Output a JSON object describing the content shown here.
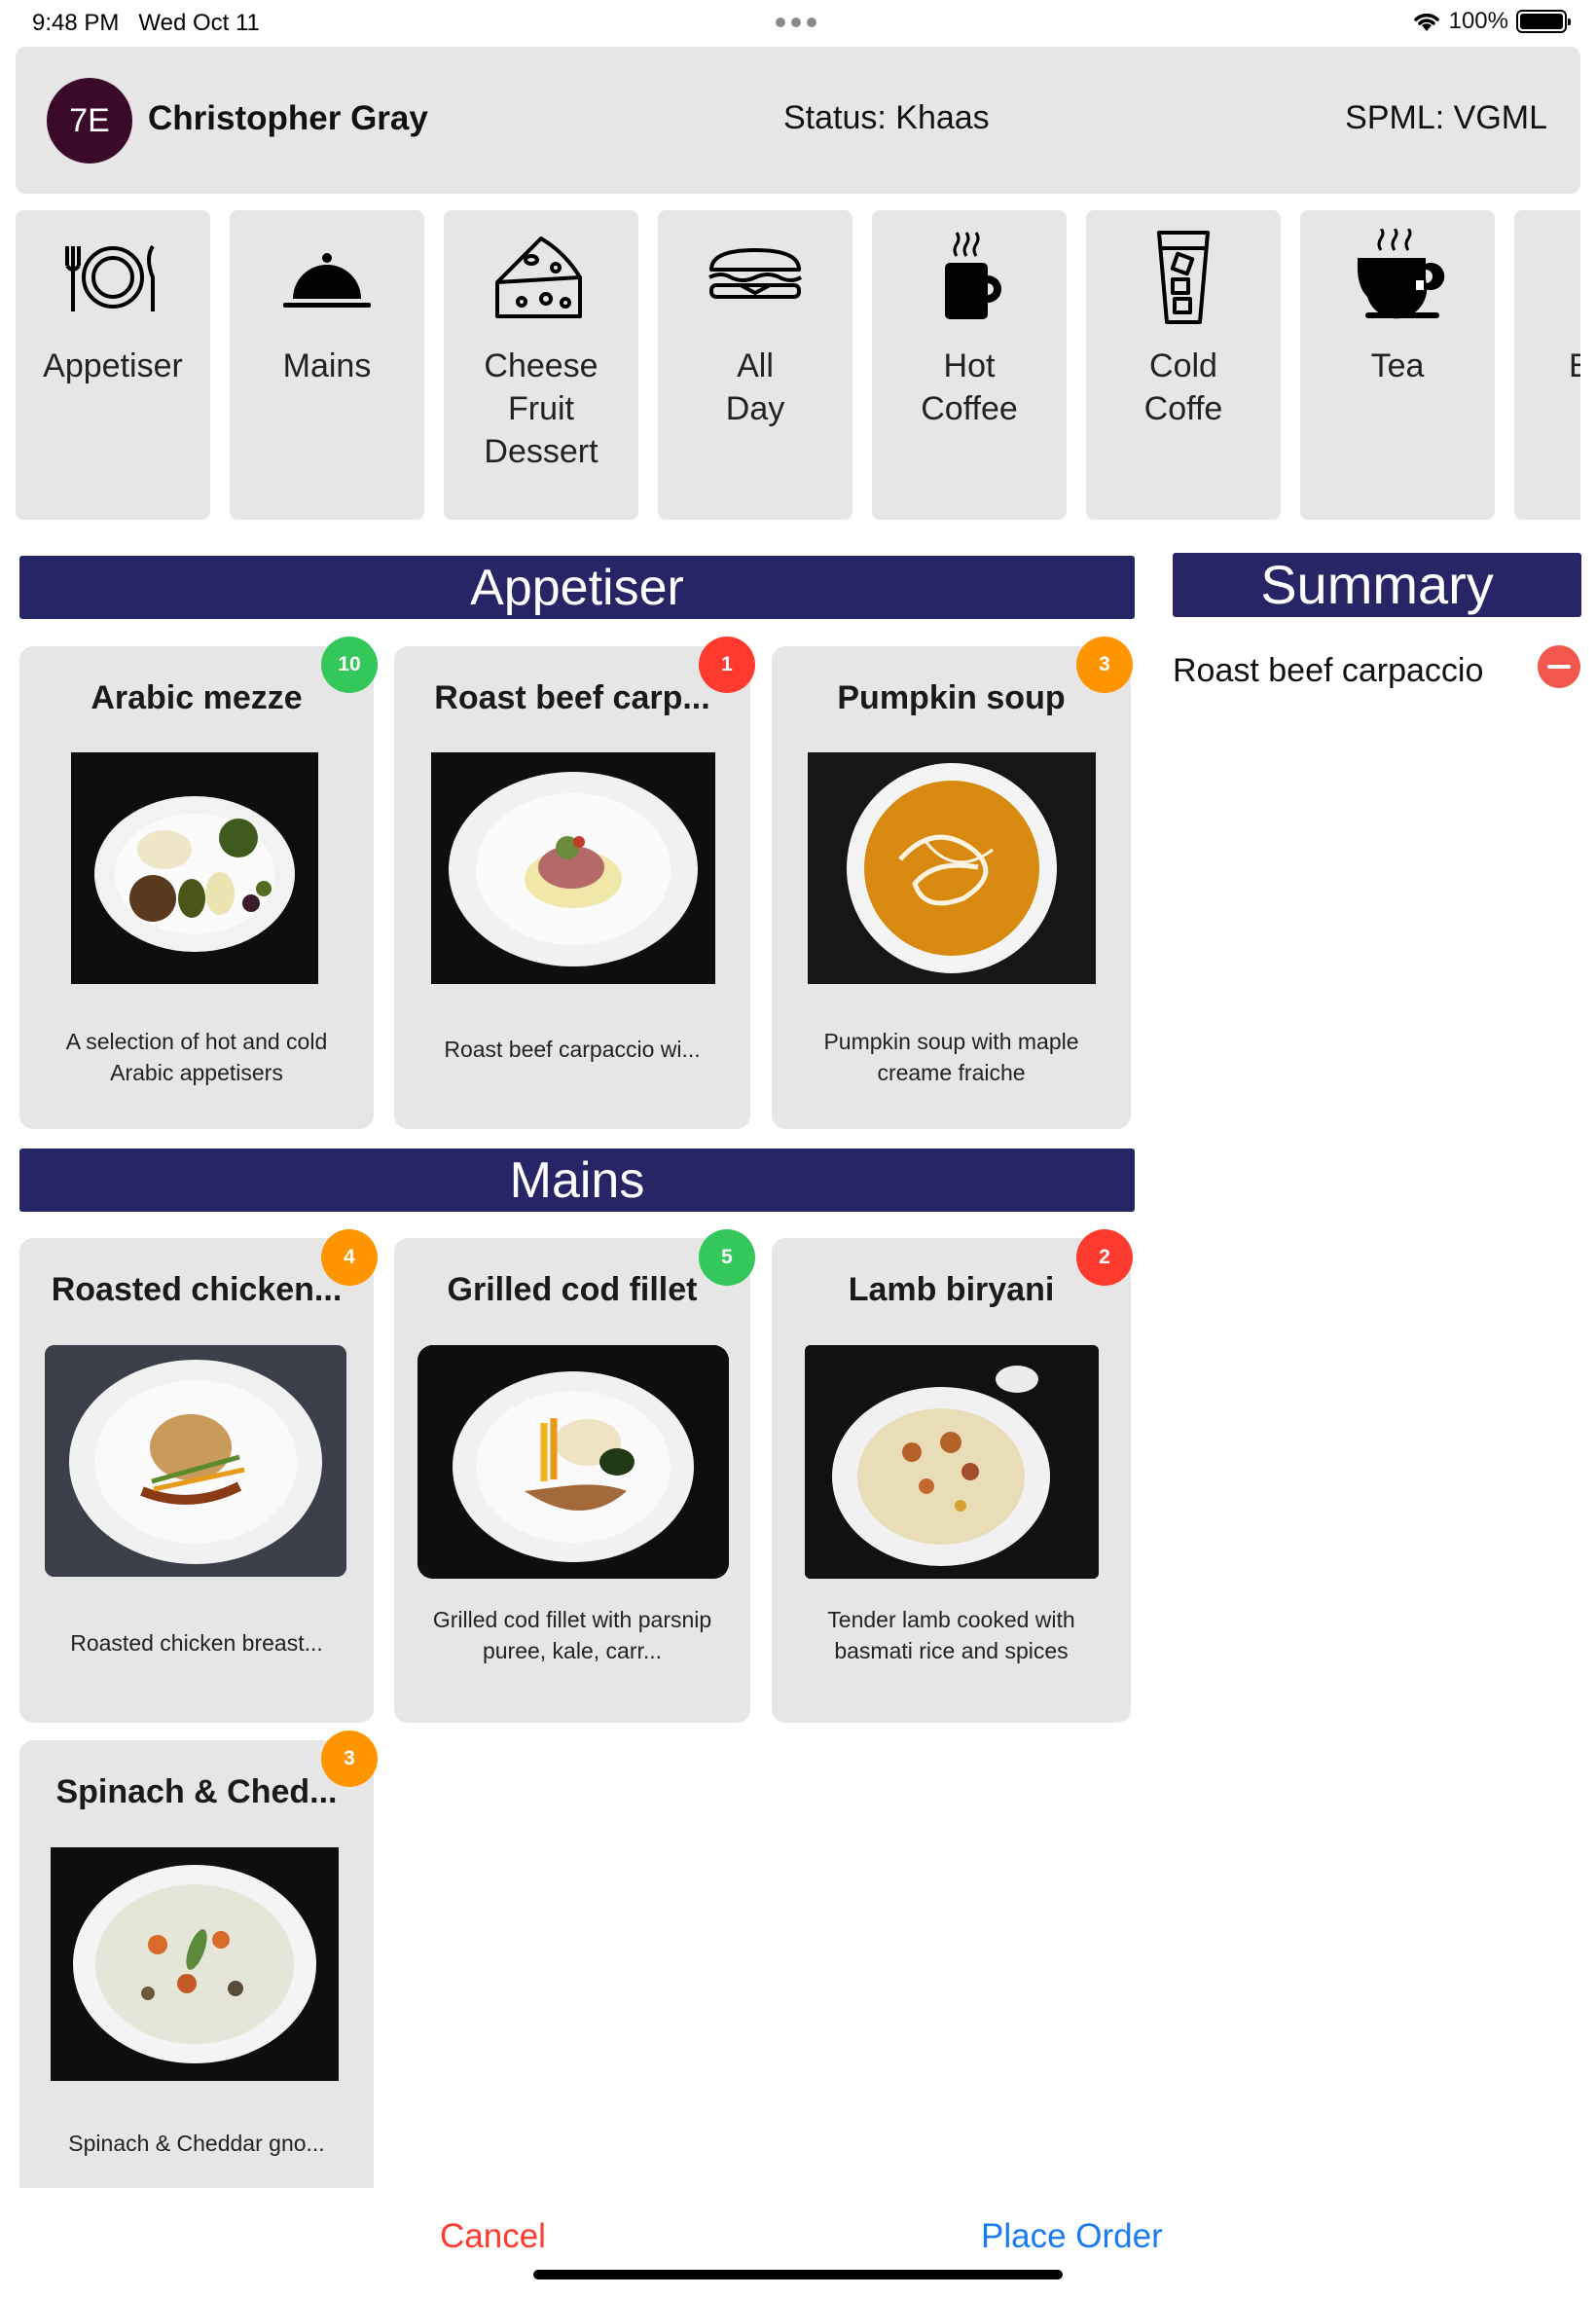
{
  "status_bar": {
    "time": "9:48 PM",
    "date": "Wed Oct 11",
    "battery": "100%"
  },
  "passenger": {
    "initials": "7E",
    "name": "Christopher Gray",
    "status": "Status: Khaas",
    "spml": "SPML: VGML"
  },
  "categories": [
    {
      "label": "Appetiser",
      "icon": "plate-cutlery-icon"
    },
    {
      "label": "Mains",
      "icon": "cloche-icon"
    },
    {
      "label": "Cheese\nFruit\nDessert",
      "icon": "cheese-icon"
    },
    {
      "label": "All\nDay",
      "icon": "sandwich-icon"
    },
    {
      "label": "Hot\nCoffee",
      "icon": "hot-coffee-icon"
    },
    {
      "label": "Cold\nCoffe",
      "icon": "iced-coffee-icon"
    },
    {
      "label": "Tea",
      "icon": "tea-cup-icon"
    },
    {
      "label": "E",
      "icon": ""
    }
  ],
  "sections": {
    "appetiser": "Appetiser",
    "mains": "Mains",
    "summary": "Summary"
  },
  "appetisers": [
    {
      "title": "Arabic mezze",
      "description": "A selection of hot and cold Arabic appetisers",
      "count": "10",
      "badge_color": "#34c759"
    },
    {
      "title": "Roast beef carp...",
      "description": "Roast beef carpaccio wi...",
      "count": "1",
      "badge_color": "#ff3b30"
    },
    {
      "title": "Pumpkin soup",
      "description": "Pumpkin soup with maple creame fraiche",
      "count": "3",
      "badge_color": "#ff9500"
    }
  ],
  "mains": [
    {
      "title": "Roasted chicken...",
      "description": "Roasted chicken breast...",
      "count": "4",
      "badge_color": "#ff9500"
    },
    {
      "title": "Grilled cod fillet",
      "description": "Grilled cod fillet with parsnip puree, kale, carr...",
      "count": "5",
      "badge_color": "#34c759"
    },
    {
      "title": "Lamb biryani",
      "description": "Tender lamb cooked with basmati rice and spices",
      "count": "2",
      "badge_color": "#ff3b30"
    },
    {
      "title": "Spinach & Ched...",
      "description": "Spinach & Cheddar gno...",
      "count": "3",
      "badge_color": "#ff9500"
    }
  ],
  "summary": {
    "items": [
      "Roast beef carpaccio"
    ]
  },
  "footer": {
    "cancel": "Cancel",
    "place_order": "Place Order"
  },
  "colors": {
    "section_bar": "#262666",
    "cancel": "#ff3b30",
    "place_order": "#1a7cf0",
    "avatar": "#3b0a2b"
  }
}
